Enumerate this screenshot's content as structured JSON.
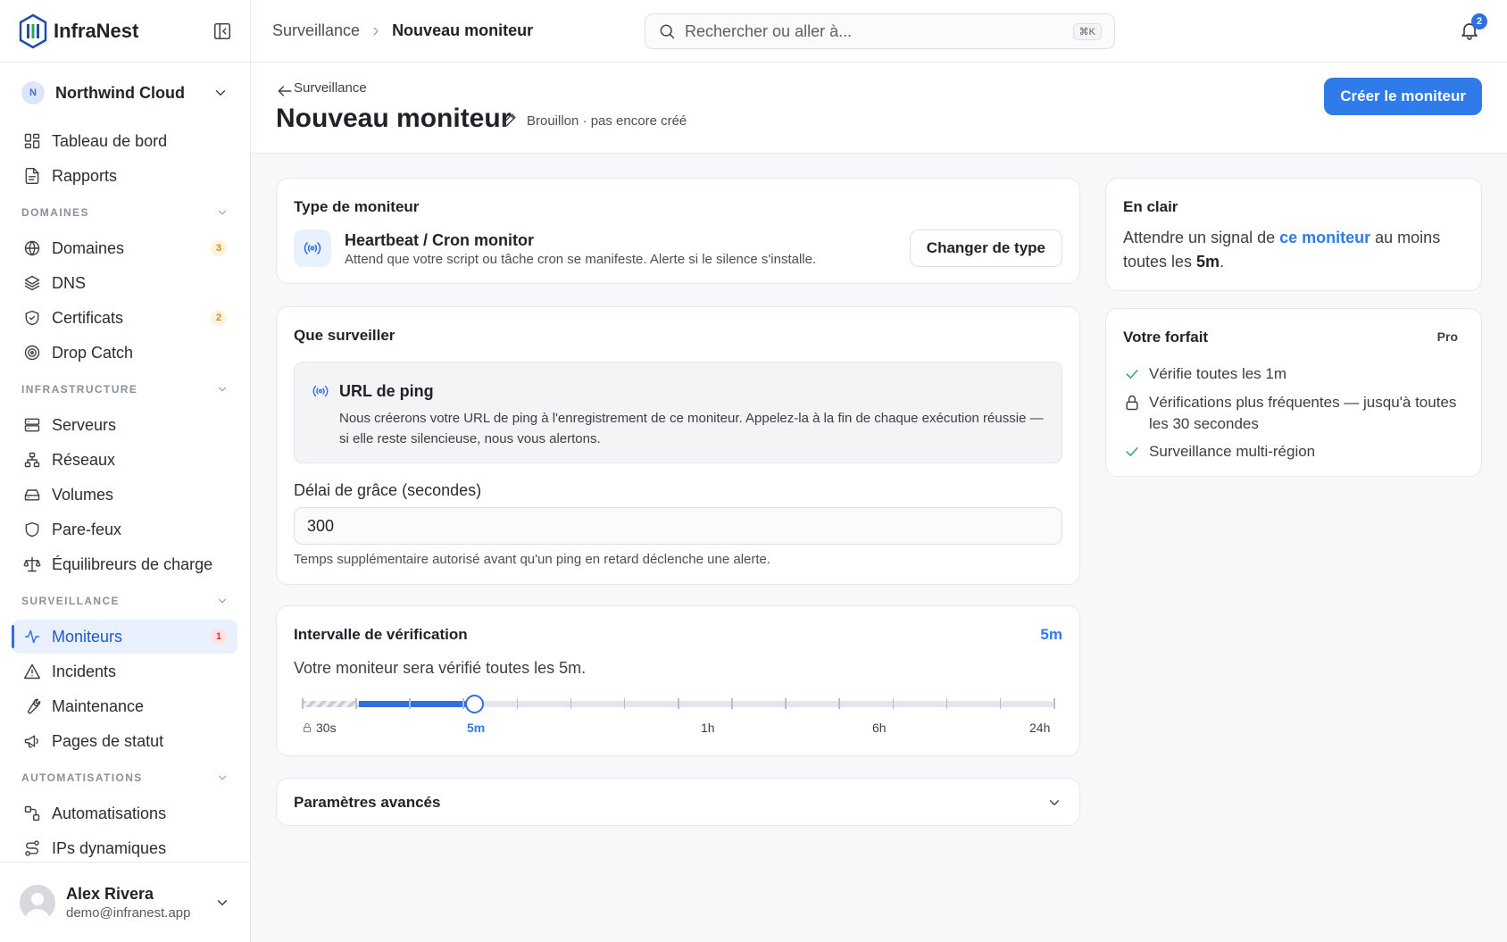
{
  "app": {
    "name": "InfraNest"
  },
  "org": {
    "initial": "N",
    "name": "Northwind Cloud"
  },
  "sidebar": {
    "top_items": [
      {
        "label": "Tableau de bord",
        "icon": "dashboard-icon"
      },
      {
        "label": "Rapports",
        "icon": "report-icon"
      }
    ],
    "sections": [
      {
        "title": "DOMAINES",
        "items": [
          {
            "label": "Domaines",
            "icon": "globe-icon",
            "badge": "3"
          },
          {
            "label": "DNS",
            "icon": "layers-icon"
          },
          {
            "label": "Certificats",
            "icon": "shield-check-icon",
            "badge": "2"
          },
          {
            "label": "Drop Catch",
            "icon": "target-icon"
          }
        ]
      },
      {
        "title": "INFRASTRUCTURE",
        "items": [
          {
            "label": "Serveurs",
            "icon": "server-icon"
          },
          {
            "label": "Réseaux",
            "icon": "network-icon"
          },
          {
            "label": "Volumes",
            "icon": "hard-drive-icon"
          },
          {
            "label": "Pare-feux",
            "icon": "shield-icon"
          },
          {
            "label": "Équilibreurs de charge",
            "icon": "scale-icon"
          }
        ]
      },
      {
        "title": "SURVEILLANCE",
        "items": [
          {
            "label": "Moniteurs",
            "icon": "activity-icon",
            "badge": "1",
            "active": true
          },
          {
            "label": "Incidents",
            "icon": "alert-triangle-icon"
          },
          {
            "label": "Maintenance",
            "icon": "wrench-icon"
          },
          {
            "label": "Pages de statut",
            "icon": "megaphone-icon"
          }
        ]
      },
      {
        "title": "AUTOMATISATIONS",
        "items": [
          {
            "label": "Automatisations",
            "icon": "workflow-icon"
          },
          {
            "label": "IPs dynamiques",
            "icon": "route-icon"
          }
        ]
      }
    ]
  },
  "user": {
    "name": "Alex Rivera",
    "email": "demo@infranest.app"
  },
  "topbar": {
    "breadcrumb_parent": "Surveillance",
    "breadcrumb_current": "Nouveau moniteur",
    "search_placeholder": "Rechercher ou aller à...",
    "search_shortcut": "⌘K",
    "notification_count": "2"
  },
  "page": {
    "back_label": "Surveillance",
    "title": "Nouveau moniteur",
    "status": "Brouillon · pas encore créé",
    "create_button": "Créer le moniteur"
  },
  "type_card": {
    "title": "Type de moniteur",
    "type_name": "Heartbeat / Cron monitor",
    "type_desc": "Attend que votre script ou tâche cron se manifeste. Alerte si le silence s'installe.",
    "change_button": "Changer de type"
  },
  "watch_card": {
    "title": "Que surveiller",
    "ping_title": "URL de ping",
    "ping_text": "Nous créerons votre URL de ping à l'enregistrement de ce moniteur. Appelez-la à la fin de chaque exécution réussie — si elle reste silencieuse, nous vous alertons.",
    "grace_label": "Délai de grâce (secondes)",
    "grace_value": "300",
    "grace_hint": "Temps supplémentaire autorisé avant qu'un ping en retard déclenche une alerte."
  },
  "interval_card": {
    "title": "Intervalle de vérification",
    "value": "5m",
    "desc": "Votre moniteur sera vérifié toutes les 5m.",
    "labels": [
      "30s",
      "5m",
      "1h",
      "6h",
      "24h"
    ],
    "selected_index": 2,
    "tick_count": 14
  },
  "advanced_card": {
    "title": "Paramètres avancés"
  },
  "clear_card": {
    "title": "En clair",
    "text_before": "Attendre un signal de ",
    "link": "ce moniteur",
    "text_middle": " au moins toutes les ",
    "interval": "5m",
    "text_after": "."
  },
  "plan_card": {
    "title": "Votre forfait",
    "badge": "Pro",
    "items": [
      {
        "text": "Vérifie toutes les 1m",
        "icon": "check-icon"
      },
      {
        "text": "Vérifications plus fréquentes — jusqu'à toutes les 30 secondes",
        "icon": "lock-icon"
      },
      {
        "text": "Surveillance multi-région",
        "icon": "check-icon"
      }
    ]
  },
  "colors": {
    "accent": "#2f7bea",
    "active_nav_bg": "#eaf1fe",
    "success": "#2aa35a",
    "badge_amber": "#d18b16",
    "badge_red": "#d83a3a"
  }
}
